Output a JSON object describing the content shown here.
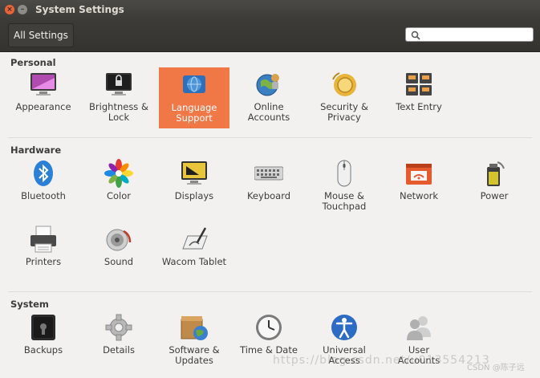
{
  "window": {
    "title": "System Settings"
  },
  "toolbar": {
    "all_settings_label": "All Settings",
    "search_placeholder": ""
  },
  "sections": {
    "personal": {
      "title": "Personal",
      "items": [
        {
          "label1": "Appearance",
          "label2": ""
        },
        {
          "label1": "Brightness &",
          "label2": "Lock"
        },
        {
          "label1": "Language",
          "label2": "Support"
        },
        {
          "label1": "Online",
          "label2": "Accounts"
        },
        {
          "label1": "Security &",
          "label2": "Privacy"
        },
        {
          "label1": "Text Entry",
          "label2": ""
        }
      ]
    },
    "hardware": {
      "title": "Hardware",
      "items": [
        {
          "label1": "Bluetooth",
          "label2": ""
        },
        {
          "label1": "Color",
          "label2": ""
        },
        {
          "label1": "Displays",
          "label2": ""
        },
        {
          "label1": "Keyboard",
          "label2": ""
        },
        {
          "label1": "Mouse &",
          "label2": "Touchpad"
        },
        {
          "label1": "Network",
          "label2": ""
        },
        {
          "label1": "Power",
          "label2": ""
        },
        {
          "label1": "Printers",
          "label2": ""
        },
        {
          "label1": "Sound",
          "label2": ""
        },
        {
          "label1": "Wacom Tablet",
          "label2": ""
        }
      ]
    },
    "system": {
      "title": "System",
      "items": [
        {
          "label1": "Backups",
          "label2": ""
        },
        {
          "label1": "Details",
          "label2": ""
        },
        {
          "label1": "Software &",
          "label2": "Updates"
        },
        {
          "label1": "Time & Date",
          "label2": ""
        },
        {
          "label1": "Universal",
          "label2": "Access"
        },
        {
          "label1": "User",
          "label2": "Accounts"
        }
      ]
    }
  },
  "watermark": {
    "url": "https://blog.csdn.net/u013554213",
    "credit": "CSDN @陈子远"
  },
  "colors": {
    "selected": "#f07746",
    "titlebar": "#3c3b37"
  }
}
